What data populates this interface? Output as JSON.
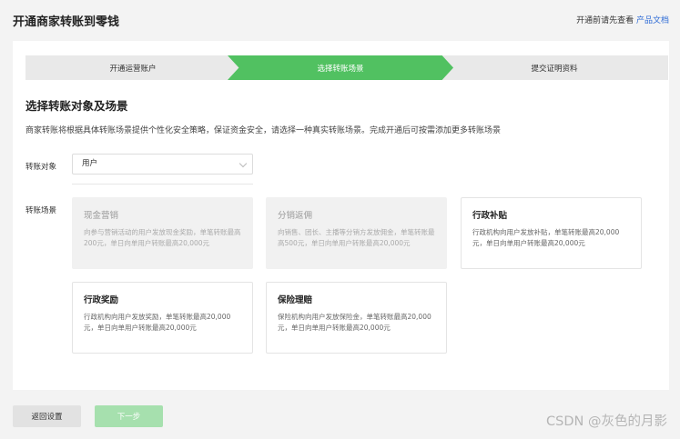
{
  "header": {
    "title": "开通商家转账到零钱",
    "hint": "开通前请先查看",
    "doc_link": "产品文档"
  },
  "steps": [
    {
      "label": "开通运营账户",
      "state": "done"
    },
    {
      "label": "选择转账场景",
      "state": "active"
    },
    {
      "label": "提交证明资料",
      "state": "pending"
    }
  ],
  "section": {
    "title": "选择转账对象及场景",
    "description": "商家转账将根据具体转账场景提供个性化安全策略，保证资金安全，请选择一种真实转账场景。完成开通后可按需添加更多转账场景"
  },
  "form": {
    "target_label": "转账对象",
    "target_value": "用户",
    "scene_label": "转账场景"
  },
  "scenes": [
    {
      "title": "现金营销",
      "desc": "向参与营销活动的用户发放现金奖励，单笔转账最高200元，单日向单用户转账最高20,000元",
      "disabled": true
    },
    {
      "title": "分销返佣",
      "desc": "向销售、团长、主播等分销方发放佣金，单笔转账最高500元，单日向单用户转账最高20,000元",
      "disabled": true
    },
    {
      "title": "行政补贴",
      "desc": "行政机构向用户发放补贴，单笔转账最高20,000元，单日向单用户转账最高20,000元",
      "disabled": false
    },
    {
      "title": "行政奖励",
      "desc": "行政机构向用户发放奖励，单笔转账最高20,000元，单日向单用户转账最高20,000元",
      "disabled": false
    },
    {
      "title": "保险理赔",
      "desc": "保险机构向用户发放保险金，单笔转账最高20,000元，单日向单用户转账最高20,000元",
      "disabled": false
    }
  ],
  "buttons": {
    "back": "返回设置",
    "next": "下一步"
  },
  "watermark": "CSDN @灰色的月影",
  "colors": {
    "accent": "#51c161",
    "link": "#2d6bd6",
    "next_disabled": "#a6e0ae"
  }
}
